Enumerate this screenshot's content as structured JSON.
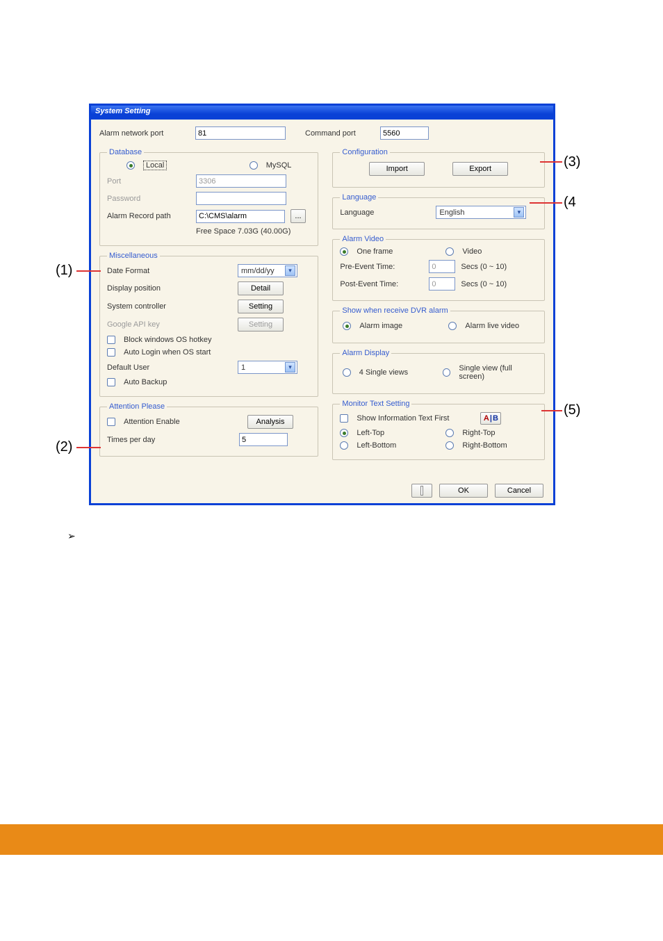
{
  "window": {
    "title": "System Setting"
  },
  "toprow": {
    "alarm_network_port_label": "Alarm network port",
    "alarm_network_port_value": "81",
    "command_port_label": "Command port",
    "command_port_value": "5560"
  },
  "database": {
    "legend": "Database",
    "local": "Local",
    "mysql": "MySQL",
    "port_label": "Port",
    "port_value": "3306",
    "password_label": "Password",
    "alarm_record_path_label": "Alarm Record path",
    "alarm_record_path_value": "C:\\CMS\\alarm",
    "browse": "...",
    "free_space": "Free Space 7.03G (40.00G)"
  },
  "misc": {
    "legend": "Miscellaneous",
    "date_format_label": "Date Format",
    "date_format_value": "mm/dd/yy",
    "display_position_label": "Display position",
    "detail_btn": "Detail",
    "system_controller_label": "System controller",
    "setting_btn": "Setting",
    "google_api_label": "Google API key",
    "google_setting_btn": "Setting",
    "block_hotkey": "Block windows OS hotkey",
    "auto_login": "Auto Login when OS start",
    "default_user_label": "Default User",
    "default_user_value": "1",
    "auto_backup": "Auto Backup"
  },
  "attention": {
    "legend": "Attention Please",
    "enable": "Attention Enable",
    "analysis_btn": "Analysis",
    "times_label": "Times per day",
    "times_value": "5"
  },
  "configuration": {
    "legend": "Configuration",
    "import_btn": "Import",
    "export_btn": "Export"
  },
  "language": {
    "legend": "Language",
    "label": "Language",
    "value": "English"
  },
  "alarm_video": {
    "legend": "Alarm Video",
    "one_frame": "One frame",
    "video": "Video",
    "pre_label": "Pre-Event Time:",
    "pre_value": "0",
    "post_label": "Post-Event Time:",
    "post_value": "0",
    "secs_range": "Secs  (0 ~ 10)"
  },
  "show_when": {
    "legend": "Show when receive DVR alarm",
    "alarm_image": "Alarm image",
    "alarm_live": "Alarm live video"
  },
  "alarm_display": {
    "legend": "Alarm Display",
    "four_single": "4 Single views",
    "single_full": "Single view (full screen)"
  },
  "monitor_text": {
    "legend": "Monitor Text Setting",
    "show_first": "Show Information Text First",
    "left_top": "Left-Top",
    "right_top": "Right-Top",
    "left_bottom": "Left-Bottom",
    "right_bottom": "Right-Bottom"
  },
  "footer": {
    "ok": "OK",
    "cancel": "Cancel"
  },
  "callouts": {
    "c1": "(1)",
    "c2": "(2)",
    "c3": "(3)",
    "c4": "(4",
    "c5": "(5)"
  },
  "bullet": "➢"
}
